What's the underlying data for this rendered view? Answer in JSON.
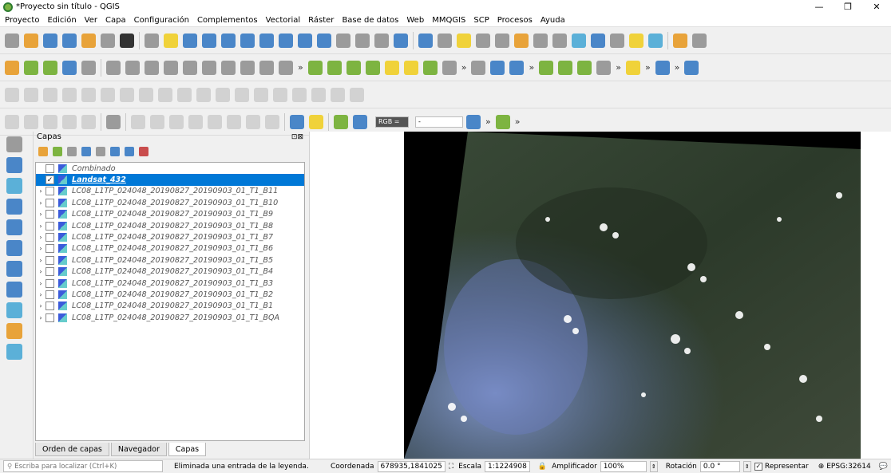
{
  "window": {
    "title": "*Proyecto sin título - QGIS",
    "controls": [
      "—",
      "❐",
      "✕"
    ]
  },
  "menu": [
    "Proyecto",
    "Edición",
    "Ver",
    "Capa",
    "Configuración",
    "Complementos",
    "Vectorial",
    "Ráster",
    "Base de datos",
    "Web",
    "MMQGIS",
    "SCP",
    "Procesos",
    "Ayuda"
  ],
  "scp_toolbar": {
    "band_set_value": "RGB =",
    "band_combo_value": "-"
  },
  "layers_panel": {
    "title": "Capas",
    "layers": [
      {
        "name": "Combinado",
        "checked": false,
        "expand": false,
        "selected": false
      },
      {
        "name": "Landsat_432",
        "checked": true,
        "expand": false,
        "selected": true
      },
      {
        "name": "LC08_L1TP_024048_20190827_20190903_01_T1_B11",
        "checked": false,
        "expand": true,
        "selected": false
      },
      {
        "name": "LC08_L1TP_024048_20190827_20190903_01_T1_B10",
        "checked": false,
        "expand": true,
        "selected": false
      },
      {
        "name": "LC08_L1TP_024048_20190827_20190903_01_T1_B9",
        "checked": false,
        "expand": true,
        "selected": false
      },
      {
        "name": "LC08_L1TP_024048_20190827_20190903_01_T1_B8",
        "checked": false,
        "expand": true,
        "selected": false
      },
      {
        "name": "LC08_L1TP_024048_20190827_20190903_01_T1_B7",
        "checked": false,
        "expand": true,
        "selected": false
      },
      {
        "name": "LC08_L1TP_024048_20190827_20190903_01_T1_B6",
        "checked": false,
        "expand": true,
        "selected": false
      },
      {
        "name": "LC08_L1TP_024048_20190827_20190903_01_T1_B5",
        "checked": false,
        "expand": true,
        "selected": false
      },
      {
        "name": "LC08_L1TP_024048_20190827_20190903_01_T1_B4",
        "checked": false,
        "expand": true,
        "selected": false
      },
      {
        "name": "LC08_L1TP_024048_20190827_20190903_01_T1_B3",
        "checked": false,
        "expand": true,
        "selected": false
      },
      {
        "name": "LC08_L1TP_024048_20190827_20190903_01_T1_B2",
        "checked": false,
        "expand": true,
        "selected": false
      },
      {
        "name": "LC08_L1TP_024048_20190827_20190903_01_T1_B1",
        "checked": false,
        "expand": true,
        "selected": false
      },
      {
        "name": "LC08_L1TP_024048_20190827_20190903_01_T1_BQA",
        "checked": false,
        "expand": true,
        "selected": false
      }
    ],
    "tabs": [
      {
        "label": "Orden de capas",
        "active": false
      },
      {
        "label": "Navegador",
        "active": false
      },
      {
        "label": "Capas",
        "active": true
      }
    ]
  },
  "statusbar": {
    "search_placeholder": "Escriba para localizar (Ctrl+K)",
    "message": "Eliminada una entrada de la leyenda.",
    "coord_label": "Coordenada",
    "coord_value": "678935,1841025",
    "scale_label": "Escala",
    "scale_value": "1:1224908",
    "magnifier_label": "Amplificador",
    "magnifier_value": "100%",
    "rotation_label": "Rotación",
    "rotation_value": "0.0 °",
    "render_label": "Representar",
    "render_checked": true,
    "crs": "EPSG:32614"
  }
}
